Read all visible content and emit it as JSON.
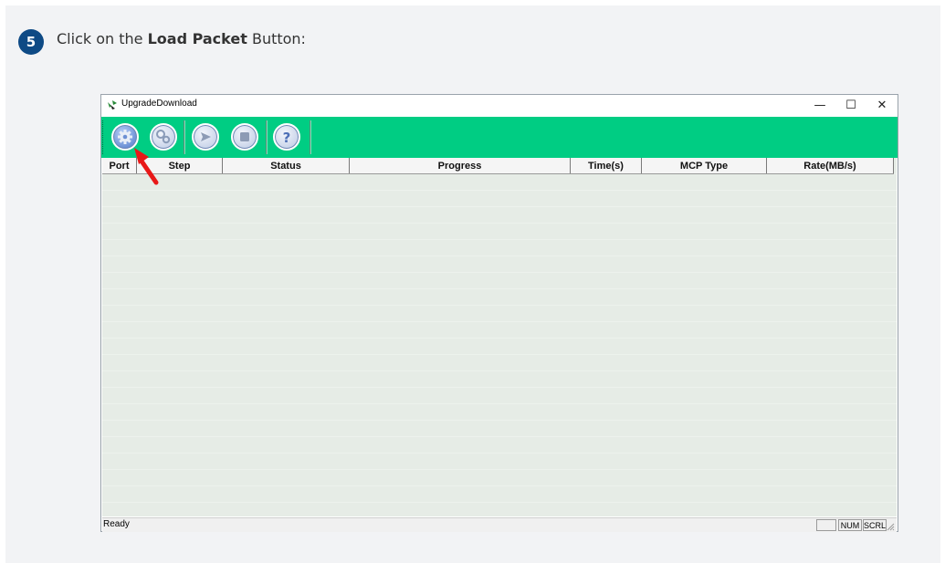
{
  "instruction": {
    "step_number": "5",
    "prefix": "Click on the ",
    "bold": "Load Packet",
    "suffix": " Button:"
  },
  "window": {
    "title": "UpgradeDownload",
    "controls": {
      "minimize": "—",
      "maximize": "☐",
      "close": "✕"
    }
  },
  "toolbar": {
    "buttons": [
      {
        "name": "load-packet-button",
        "icon": "gear-icon"
      },
      {
        "name": "settings-button",
        "icon": "gears-icon"
      },
      {
        "name": "start-button",
        "icon": "play-icon"
      },
      {
        "name": "stop-button",
        "icon": "stop-icon"
      },
      {
        "name": "help-button",
        "icon": "question-icon"
      }
    ]
  },
  "table": {
    "columns": [
      "Port",
      "Step",
      "Status",
      "Progress",
      "Time(s)",
      "MCP Type",
      "Rate(MB/s)"
    ]
  },
  "statusbar": {
    "text": "Ready",
    "indicators": [
      "",
      "NUM",
      "SCRL"
    ]
  },
  "colors": {
    "toolbar": "#00cd83",
    "step_badge": "#0e4a85",
    "annotation_arrow": "#e81818"
  }
}
